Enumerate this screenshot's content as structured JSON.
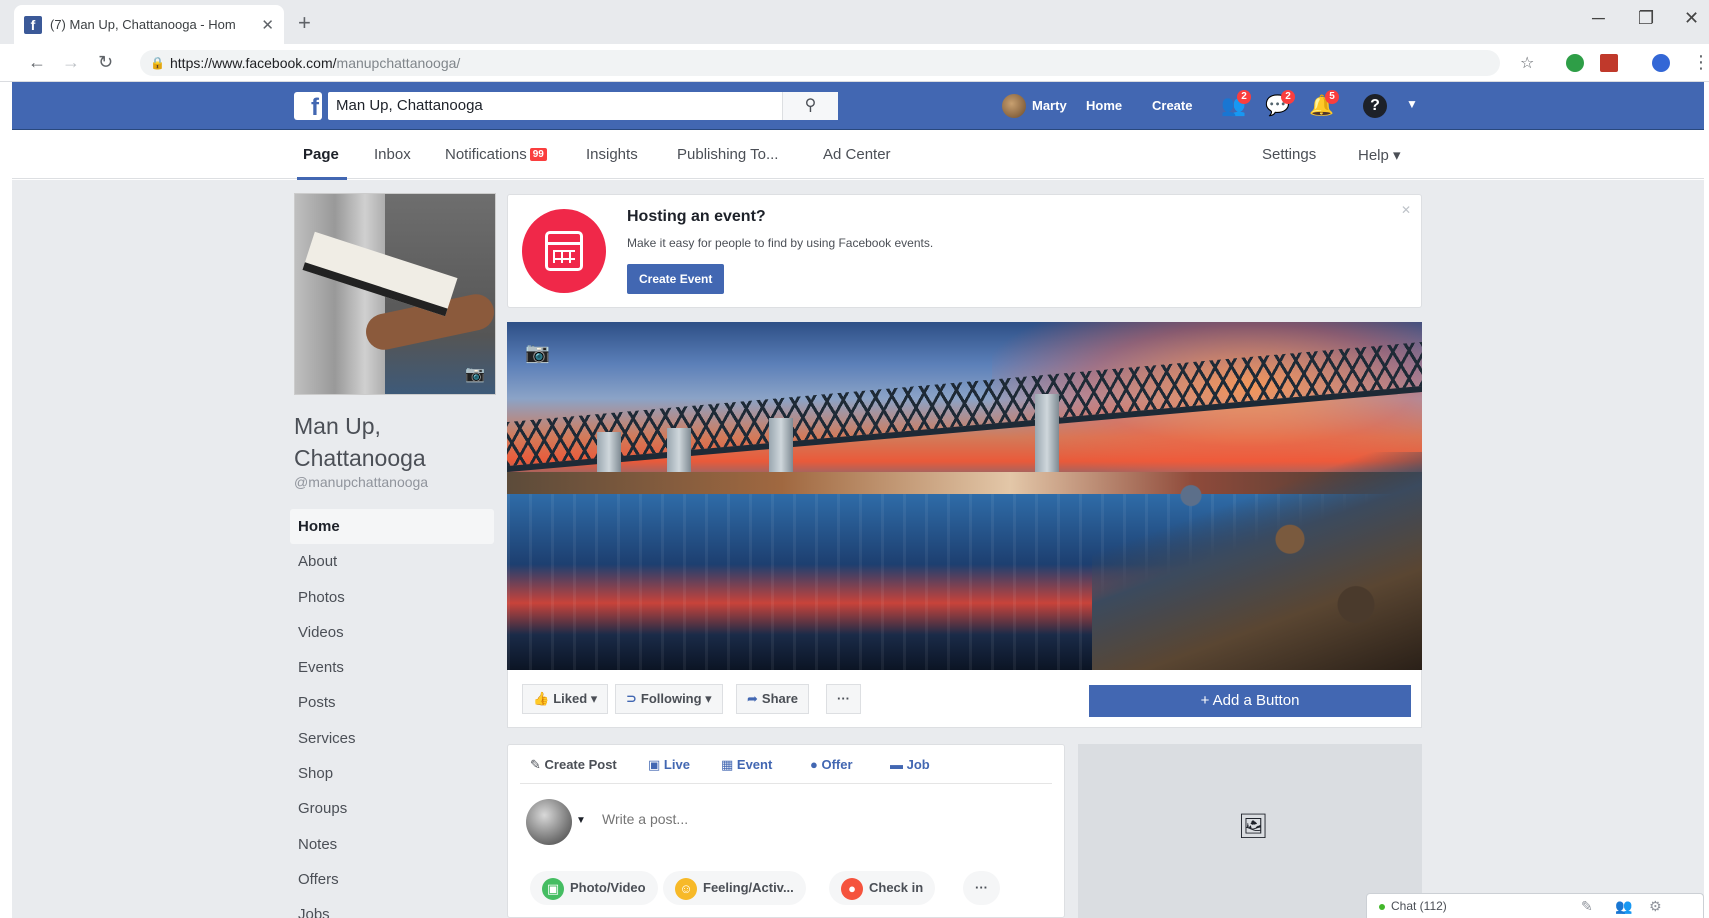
{
  "browser": {
    "tab_title": "(7) Man Up, Chattanooga - Hom",
    "url_prefix": "https://www.facebook.com/",
    "url_path": "manupchattanooga/"
  },
  "topbar": {
    "search_value": "Man Up, Chattanooga",
    "user_name": "Marty",
    "home_label": "Home",
    "create_label": "Create",
    "friend_requests_count": "2",
    "messages_count": "2",
    "notifications_count": "5"
  },
  "page_tabs": {
    "page": "Page",
    "inbox": "Inbox",
    "notifications": "Notifications",
    "notifications_badge": "99",
    "insights": "Insights",
    "publishing": "Publishing To...",
    "ad_center": "Ad Center",
    "settings": "Settings",
    "help": "Help ▾"
  },
  "page": {
    "name": "Man Up, Chattanooga",
    "handle": "@manupchattanooga"
  },
  "sidenav": [
    "Home",
    "About",
    "Photos",
    "Videos",
    "Events",
    "Posts",
    "Services",
    "Shop",
    "Groups",
    "Notes",
    "Offers",
    "Jobs"
  ],
  "event_card": {
    "title": "Hosting an event?",
    "subtitle": "Make it easy for people to find by using Facebook events.",
    "button": "Create Event"
  },
  "actions": {
    "liked": "Liked ▾",
    "following": "Following ▾",
    "share": "Share",
    "more": "···",
    "add_button": "+ Add a Button"
  },
  "composer": {
    "tabs": [
      "Create Post",
      "Live",
      "Event",
      "Offer",
      "Job"
    ],
    "placeholder": "Write a post...",
    "buttons": [
      "Photo/Video",
      "Feeling/Activ...",
      "Check in",
      "···"
    ]
  },
  "chat": {
    "label": "Chat (112)"
  },
  "colors": {
    "facebook_blue": "#4267b2",
    "event_red": "#f02849",
    "badge_red": "#fa3e3e",
    "page_bg": "#e9ebee"
  }
}
